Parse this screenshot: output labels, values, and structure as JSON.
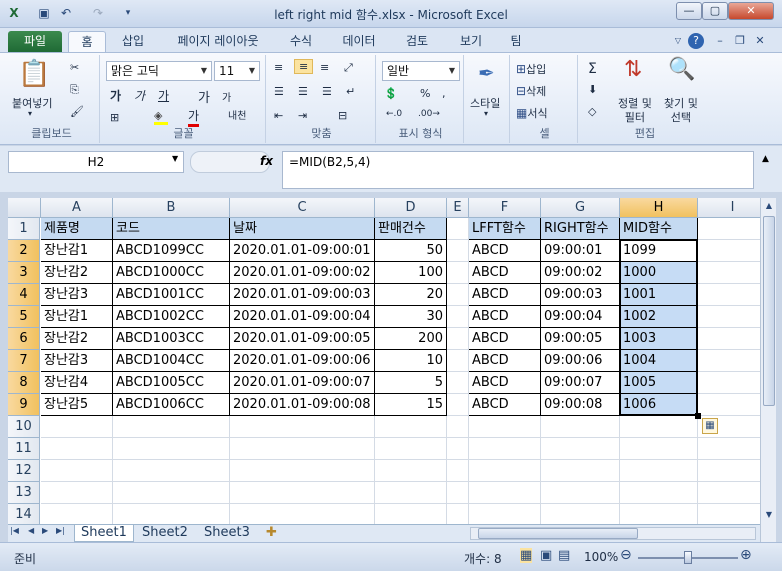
{
  "window": {
    "title": "left right mid 함수.xlsx - Microsoft Excel"
  },
  "tabs": [
    "파일",
    "홈",
    "삽입",
    "페이지 레이아웃",
    "수식",
    "데이터",
    "검토",
    "보기",
    "팀"
  ],
  "ribbon": {
    "paste": "붙여넣기",
    "clipboard": "클립보드",
    "font_name": "맑은 고딕",
    "font_size": "11",
    "bold": "가",
    "italic": "가",
    "underline": "가",
    "grow": "가",
    "shrink": "가",
    "phonetic": "내천",
    "font_color": "가",
    "font_group": "글꼴",
    "align_group": "맞춤",
    "number_format": "일반",
    "number_group": "표시 형식",
    "style": "스타일",
    "insert": "삽입",
    "delete": "삭제",
    "format": "서식",
    "cells_group": "셀",
    "sort": "정렬 및\n필터",
    "find": "찾기 및\n선택",
    "editing_group": "편집"
  },
  "formula_bar": {
    "name_box": "H2",
    "fx": "fx",
    "formula": "=MID(B2,5,4)"
  },
  "columns": [
    {
      "id": "A",
      "w": 72
    },
    {
      "id": "B",
      "w": 117
    },
    {
      "id": "C",
      "w": 145
    },
    {
      "id": "D",
      "w": 72
    },
    {
      "id": "E",
      "w": 22
    },
    {
      "id": "F",
      "w": 72
    },
    {
      "id": "G",
      "w": 79
    },
    {
      "id": "H",
      "w": 78
    },
    {
      "id": "I",
      "w": 70
    }
  ],
  "header_row": [
    "제품명",
    "코드",
    "날짜",
    "판매건수",
    "",
    "LFFT함수",
    "RIGHT함수",
    "MID함수"
  ],
  "rows": [
    [
      "장난감1",
      "ABCD1099CC",
      "2020.01.01-09:00:01",
      "50",
      "",
      "ABCD",
      "09:00:01",
      "1099"
    ],
    [
      "장난감2",
      "ABCD1000CC",
      "2020.01.01-09:00:02",
      "100",
      "",
      "ABCD",
      "09:00:02",
      "1000"
    ],
    [
      "장난감3",
      "ABCD1001CC",
      "2020.01.01-09:00:03",
      "20",
      "",
      "ABCD",
      "09:00:03",
      "1001"
    ],
    [
      "장난감1",
      "ABCD1002CC",
      "2020.01.01-09:00:04",
      "30",
      "",
      "ABCD",
      "09:00:04",
      "1002"
    ],
    [
      "장난감2",
      "ABCD1003CC",
      "2020.01.01-09:00:05",
      "200",
      "",
      "ABCD",
      "09:00:05",
      "1003"
    ],
    [
      "장난감3",
      "ABCD1004CC",
      "2020.01.01-09:00:06",
      "10",
      "",
      "ABCD",
      "09:00:06",
      "1004"
    ],
    [
      "장난감4",
      "ABCD1005CC",
      "2020.01.01-09:00:07",
      "5",
      "",
      "ABCD",
      "09:00:07",
      "1005"
    ],
    [
      "장난감5",
      "ABCD1006CC",
      "2020.01.01-09:00:08",
      "15",
      "",
      "ABCD",
      "09:00:08",
      "1006"
    ]
  ],
  "row_numbers": [
    "1",
    "2",
    "3",
    "4",
    "5",
    "6",
    "7",
    "8",
    "9",
    "10",
    "11",
    "12",
    "13",
    "14"
  ],
  "sheets": [
    "Sheet1",
    "Sheet2",
    "Sheet3"
  ],
  "status": {
    "ready": "준비",
    "count": "개수: 8",
    "zoom": "100%"
  }
}
